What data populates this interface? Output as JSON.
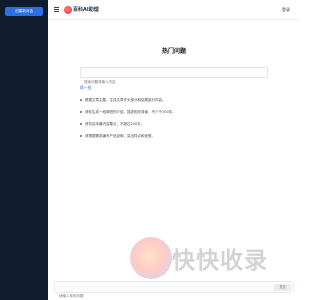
{
  "sidebar": {
    "new_chat_label": "创建新对话"
  },
  "header": {
    "brand": "百科AI助理",
    "login_label": "登录"
  },
  "main": {
    "title": "热门问题",
    "search_placeholder": "搜索问题或输入内容",
    "refresh_label": "换一批",
    "suggestions": [
      "根据文章主题，生成文章开头部分和结尾部分内容。",
      "请你生成一段简短的介绍，描述相关背景，不少于300字。",
      "请总结本篇内容要点，不超过200字。",
      "请根据需求编写产品说明，突出特点和优势。"
    ]
  },
  "watermark": {
    "text": "快快收录"
  },
  "composer": {
    "placeholder": "请输入你的问题",
    "send_label": "发送"
  }
}
